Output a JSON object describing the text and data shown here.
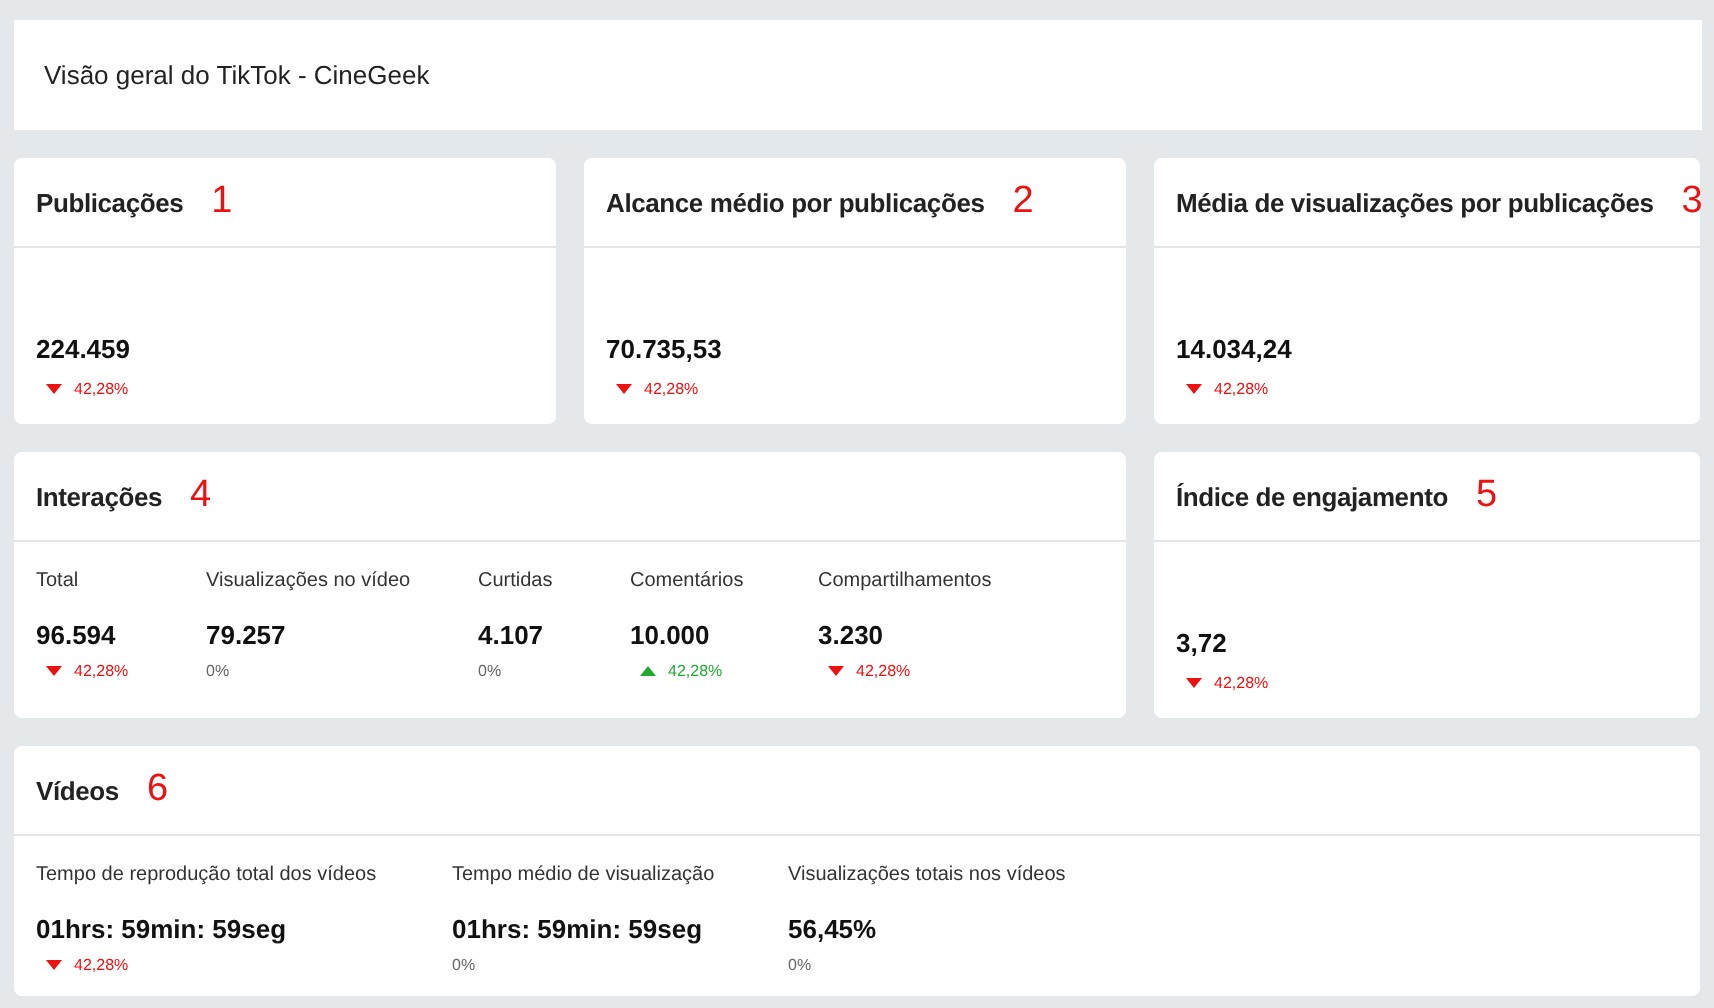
{
  "header": {
    "title": "Visão geral do TikTok - CineGeek"
  },
  "cards": [
    {
      "title": "Publicações",
      "marker": "1",
      "kind": "single",
      "metrics": [
        {
          "value": "224.459",
          "kind": "down",
          "change": "42,28%"
        }
      ]
    },
    {
      "title": "Alcance médio por publicações",
      "marker": "2",
      "kind": "single",
      "metrics": [
        {
          "value": "70.735,53",
          "kind": "down",
          "change": "42,28%"
        }
      ]
    },
    {
      "title": "Média de visualizações por publicações",
      "marker": "3",
      "kind": "single",
      "metrics": [
        {
          "value": "14.034,24",
          "kind": "down",
          "change": "42,28%"
        }
      ]
    },
    {
      "title": "Interações",
      "marker": "4",
      "kind": "columns",
      "metrics": [
        {
          "label": "Total",
          "value": "96.594",
          "kind": "down",
          "change": "42,28%"
        },
        {
          "label": "Visualizações no vídeo",
          "value": "79.257",
          "kind": "flat",
          "change": "0%"
        },
        {
          "label": "Curtidas",
          "value": "4.107",
          "kind": "flat",
          "change": "0%"
        },
        {
          "label": "Comentários",
          "value": "10.000",
          "kind": "up",
          "change": "42,28%"
        },
        {
          "label": "Compartilhamentos",
          "value": "3.230",
          "kind": "down",
          "change": "42,28%"
        }
      ]
    },
    {
      "title": "Índice de engajamento",
      "marker": "5",
      "kind": "single",
      "metrics": [
        {
          "value": "3,72",
          "kind": "down",
          "change": "42,28%"
        }
      ]
    },
    {
      "title": "Vídeos",
      "marker": "6",
      "kind": "columns",
      "metrics": [
        {
          "label": "Tempo de reprodução total dos vídeos",
          "value": "01hrs: 59min: 59seg",
          "kind": "down",
          "change": "42,28%"
        },
        {
          "label": "Tempo médio de visualização",
          "value": "01hrs: 59min: 59seg",
          "kind": "flat",
          "change": "0%"
        },
        {
          "label": "Visualizações totais nos vídeos",
          "value": "56,45%",
          "kind": "flat",
          "change": "0%"
        }
      ]
    }
  ]
}
